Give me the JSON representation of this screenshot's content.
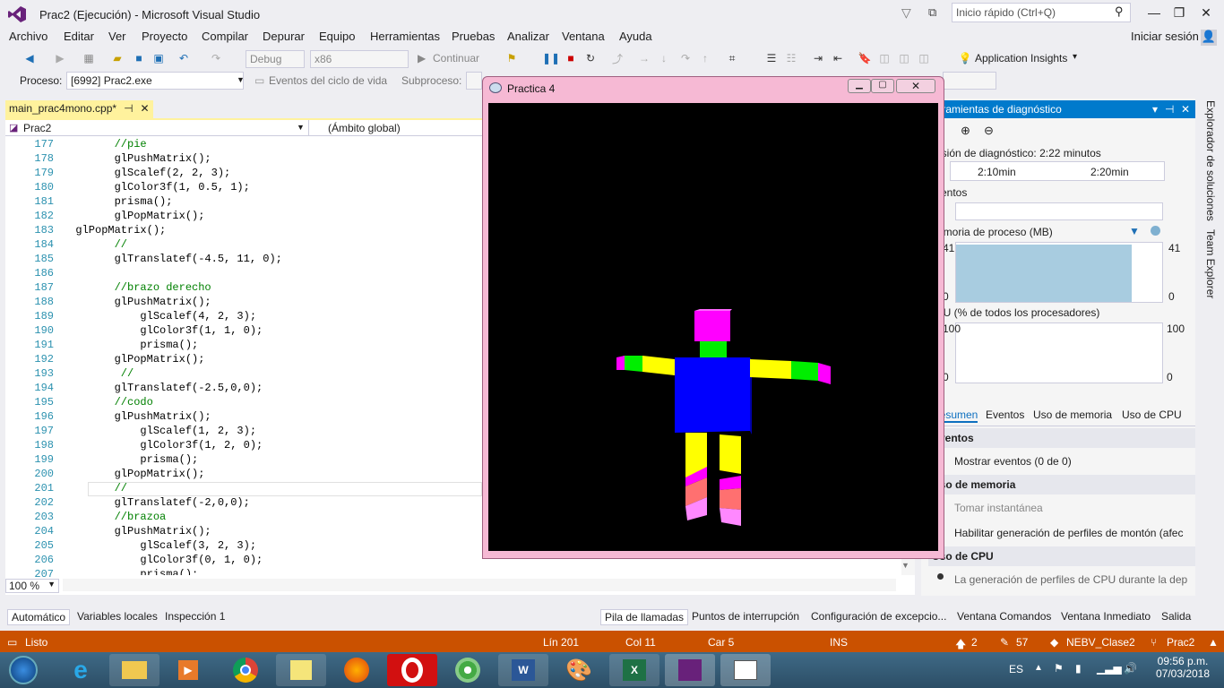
{
  "window": {
    "title": "Prac2 (Ejecución) - Microsoft Visual Studio",
    "quick_launch_placeholder": "Inicio rápido (Ctrl+Q)",
    "signin": "Iniciar sesión"
  },
  "menu": [
    "Archivo",
    "Editar",
    "Ver",
    "Proyecto",
    "Compilar",
    "Depurar",
    "Equipo",
    "Herramientas",
    "Pruebas",
    "Analizar",
    "Ventana",
    "Ayuda"
  ],
  "toolbar": {
    "config": "Debug",
    "platform": "x86",
    "continue_label": "Continuar",
    "app_insights": "Application Insights"
  },
  "debugbar": {
    "process_label": "Proceso:",
    "process_value": "[6992] Prac2.exe",
    "lifecycle_label": "Eventos del ciclo de vida",
    "subprocess_label": "Subproceso:"
  },
  "editor": {
    "tab_name": "main_prac4mono.cpp*",
    "project": "Prac2",
    "scope": "(Ámbito global)",
    "zoom": "100 %",
    "lines": [
      {
        "n": "177",
        "t": "        //pie",
        "c": true
      },
      {
        "n": "178",
        "t": "        glPushMatrix();",
        "c": false
      },
      {
        "n": "179",
        "t": "        glScalef(2, 2, 3);",
        "c": false
      },
      {
        "n": "180",
        "t": "        glColor3f(1, 0.5, 1);",
        "c": false
      },
      {
        "n": "181",
        "t": "        prisma();",
        "c": false
      },
      {
        "n": "182",
        "t": "        glPopMatrix();",
        "c": false
      },
      {
        "n": "183",
        "t": "  glPopMatrix();",
        "c": false
      },
      {
        "n": "184",
        "t": "        //",
        "c": true
      },
      {
        "n": "185",
        "t": "        glTranslatef(-4.5, 11, 0);",
        "c": false
      },
      {
        "n": "186",
        "t": "",
        "c": false
      },
      {
        "n": "187",
        "t": "        //brazo derecho",
        "c": true
      },
      {
        "n": "188",
        "t": "        glPushMatrix();",
        "c": false
      },
      {
        "n": "189",
        "t": "            glScalef(4, 2, 3);",
        "c": false
      },
      {
        "n": "190",
        "t": "            glColor3f(1, 1, 0);",
        "c": false
      },
      {
        "n": "191",
        "t": "            prisma();",
        "c": false
      },
      {
        "n": "192",
        "t": "        glPopMatrix();",
        "c": false
      },
      {
        "n": "193",
        "t": "         //",
        "c": true
      },
      {
        "n": "194",
        "t": "        glTranslatef(-2.5,0,0);",
        "c": false
      },
      {
        "n": "195",
        "t": "        //codo",
        "c": true
      },
      {
        "n": "196",
        "t": "        glPushMatrix();",
        "c": false
      },
      {
        "n": "197",
        "t": "            glScalef(1, 2, 3);",
        "c": false
      },
      {
        "n": "198",
        "t": "            glColor3f(1, 2, 0);",
        "c": false
      },
      {
        "n": "199",
        "t": "            prisma();",
        "c": false
      },
      {
        "n": "200",
        "t": "        glPopMatrix();",
        "c": false
      },
      {
        "n": "201",
        "t": "        //",
        "c": true
      },
      {
        "n": "202",
        "t": "        glTranslatef(-2,0,0);",
        "c": false
      },
      {
        "n": "203",
        "t": "        //brazoa",
        "c": true
      },
      {
        "n": "204",
        "t": "        glPushMatrix();",
        "c": false
      },
      {
        "n": "205",
        "t": "            glScalef(3, 2, 3);",
        "c": false
      },
      {
        "n": "206",
        "t": "            glColor3f(0, 1, 0);",
        "c": false
      },
      {
        "n": "207",
        "t": "            prisma();",
        "c": false
      }
    ]
  },
  "glwindow": {
    "title": "Practica 4"
  },
  "diagnostics": {
    "title": "Herramientas de diagnóstico",
    "session": "Sesión de diagnóstico: 2:22 minutos",
    "tick1": "2:10min",
    "tick2": "2:20min",
    "events": "Eventos",
    "memory": "Memoria de proceso (MB)",
    "mem_max": "41",
    "mem_min": "0",
    "mem_left_top": "41",
    "mem_left_bot": "0",
    "mem_fill": 0.85,
    "cpu": "CPU (% de todos los procesadores)",
    "cpu_max": "100",
    "cpu_min": "0",
    "cpu_left_top": "100",
    "cpu_left_bot": "0",
    "tabs": [
      "Resumen",
      "Eventos",
      "Uso de memoria",
      "Uso de CPU"
    ],
    "sec_events": "Eventos",
    "show_events": "Mostrar eventos (0 de 0)",
    "sec_memory": "Uso de memoria",
    "snapshot": "Tomar instantánea",
    "heap": "Habilitar generación de perfiles de montón (afec",
    "sec_cpu": "Uso de CPU",
    "cpu_note": "La generación de perfiles de CPU durante la dep"
  },
  "rail": [
    "Explorador de soluciones",
    "Team Explorer"
  ],
  "bottom": {
    "left_tabs": [
      "Automático",
      "Variables locales",
      "Inspección 1"
    ],
    "right_tabs": [
      "Pila de llamadas",
      "Puntos de interrupción",
      "Configuración de excepcio...",
      "Ventana Comandos",
      "Ventana Inmediato",
      "Salida"
    ]
  },
  "status": {
    "ready": "Listo",
    "line": "Lín 201",
    "col": "Col 11",
    "char": "Car 5",
    "ins": "INS",
    "up": "2",
    "pencil": "57",
    "repo": "NEBV_Clase2",
    "branch": "Prac2"
  },
  "taskbar": {
    "lang": "ES",
    "time": "09:56 p.m.",
    "date": "07/03/2018"
  }
}
